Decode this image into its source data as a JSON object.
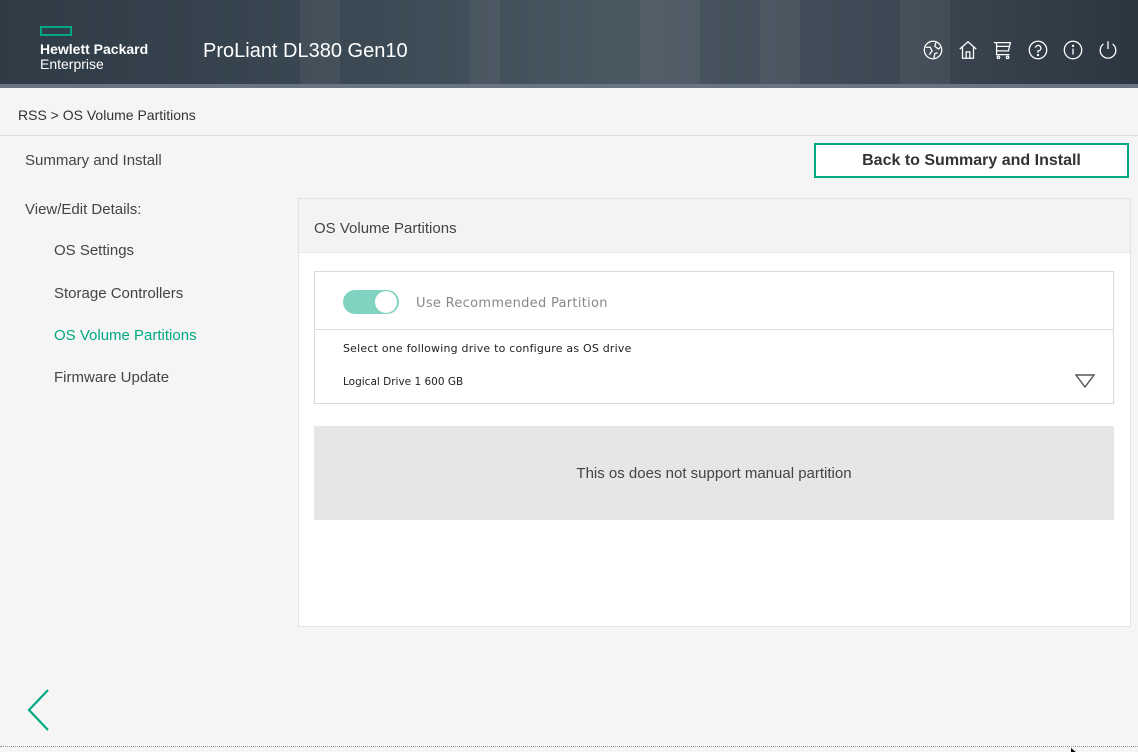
{
  "header": {
    "brand_line1": "Hewlett Packard",
    "brand_line2": "Enterprise",
    "product": "ProLiant DL380 Gen10",
    "icons": [
      "globe-icon",
      "home-icon",
      "cart-icon",
      "help-icon",
      "info-icon",
      "power-icon"
    ]
  },
  "breadcrumb": "RSS > OS Volume Partitions",
  "sidebar": {
    "summary": "Summary and Install",
    "view_edit": "View/Edit Details:",
    "items": [
      {
        "label": "OS Settings"
      },
      {
        "label": "Storage Controllers"
      },
      {
        "label": "OS Volume Partitions",
        "active": true
      },
      {
        "label": "Firmware Update"
      }
    ]
  },
  "back_button": "Back to Summary and Install",
  "panel": {
    "title": "OS Volume Partitions",
    "toggle_label": "Use Recommended Partition",
    "toggle_on": true,
    "select_prompt": "Select one following drive to configure as OS drive",
    "selected_drive": "Logical Drive 1 600 GB",
    "notice": "This os does not support manual partition"
  },
  "colors": {
    "accent": "#01a982",
    "toggle": "#7fd3c0"
  }
}
